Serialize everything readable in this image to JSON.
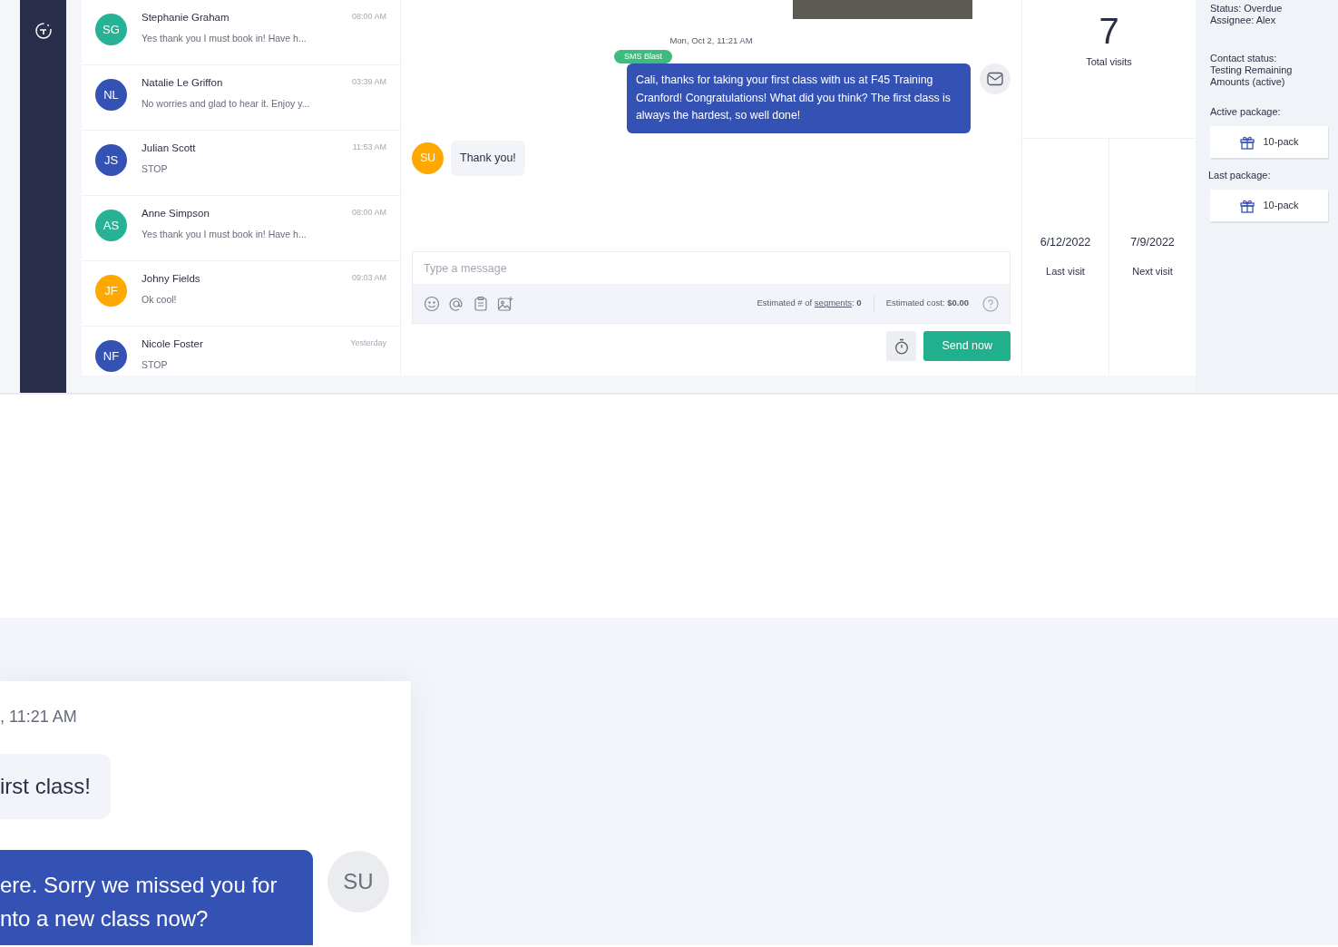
{
  "conversations": [
    {
      "initials": "SG",
      "color": "#26b294",
      "name": "Stephanie Graham",
      "preview": "Yes thank you I must book in! Have h...",
      "time": "08:00 AM"
    },
    {
      "initials": "NL",
      "color": "#3452b4",
      "name": "Natalie Le Griffon",
      "preview": "No worries and glad to hear it. Enjoy y...",
      "time": "03:39 AM"
    },
    {
      "initials": "JS",
      "color": "#3452b4",
      "name": "Julian Scott",
      "preview": "STOP",
      "time": "11:53 AM"
    },
    {
      "initials": "AS",
      "color": "#26b294",
      "name": "Anne Simpson",
      "preview": "Yes thank you I must book in! Have h...",
      "time": "08:00 AM"
    },
    {
      "initials": "JF",
      "color": "#ffa800",
      "name": "Johny Fields",
      "preview": "Ok cool!",
      "time": "09:03 AM"
    },
    {
      "initials": "NF",
      "color": "#3452b4",
      "name": "Nicole Foster",
      "preview": "STOP",
      "time": "Yesterday"
    }
  ],
  "chat": {
    "date": "Mon, Oct 2, 11:21 AM",
    "messages": [
      {
        "kind": "outgoing",
        "tag": "SMS Blast",
        "text": "Cali, thanks for taking your first class with us at F45 Training Cranford! Congratulations! What did you think? The first class is always the hardest, so well done!"
      },
      {
        "kind": "incoming",
        "initials": "SU",
        "text": "Thank you!"
      }
    ],
    "composer": {
      "placeholder": "Type a message",
      "segments_label": "Estimated # of",
      "segments_link": "segments",
      "segments_colon": ":",
      "segments_value": "0",
      "cost_label": "Estimated cost:",
      "cost_value": "$0.00"
    },
    "send_button": "Send now"
  },
  "stats": {
    "total": "7",
    "total_label": "Total visits",
    "last_visit": "6/12/2022",
    "last_visit_label": "Last visit",
    "next_visit": "7/9/2022",
    "next_visit_label": "Next visit"
  },
  "details": {
    "status": "Status: Overdue",
    "assignee": "Assignee: Alex",
    "contact_status_label": "Contact status:",
    "contact_status": "Testing Remaining Amounts (active)",
    "active_package_label": "Active package:",
    "active_package": "10-pack",
    "last_package_label": "Last package:",
    "last_package": "10-pack"
  },
  "preview_card": {
    "date": ", 11:21 AM",
    "incoming": "irst class!",
    "outgoing": "ere. Sorry we missed you for\nnto a new class now?",
    "initials": "SU"
  }
}
